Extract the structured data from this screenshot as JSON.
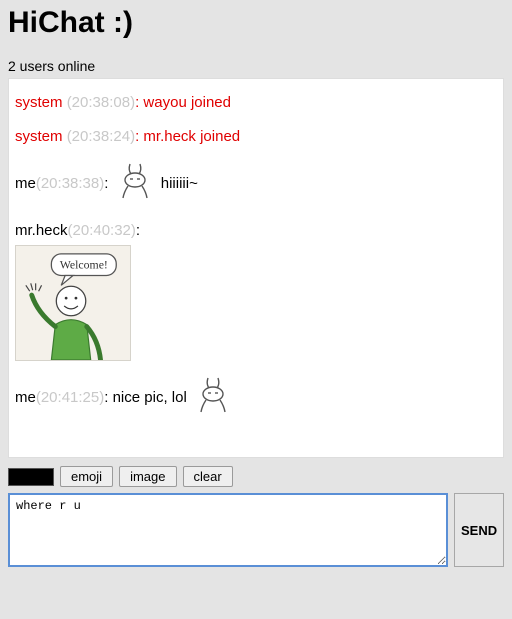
{
  "title": "HiChat :)",
  "status_text": "2 users online",
  "toolbar": {
    "emoji_label": "emoji",
    "image_label": "image",
    "clear_label": "clear",
    "swatch_color": "#000000"
  },
  "compose": {
    "input_value": "where r u",
    "send_label": "SEND"
  },
  "messages": [
    {
      "kind": "system",
      "who": "system",
      "time": "(20:38:08)",
      "colon": ":",
      "text": "wayou joined"
    },
    {
      "kind": "system",
      "who": "system",
      "time": "(20:38:24)",
      "colon": ":",
      "text": "mr.heck joined"
    },
    {
      "kind": "user",
      "who": "me",
      "time": "(20:38:38)",
      "colon": ":",
      "emoji": "bunny",
      "text": "hiiiiii~"
    },
    {
      "kind": "user",
      "who": "mr.heck",
      "time": "(20:40:32)",
      "colon": ":",
      "image": "welcome",
      "image_caption": "Welcome!"
    },
    {
      "kind": "user",
      "who": "me",
      "time": "(20:41:25)",
      "colon": ":",
      "text": "nice pic, lol",
      "emoji_after": "bunny"
    }
  ]
}
